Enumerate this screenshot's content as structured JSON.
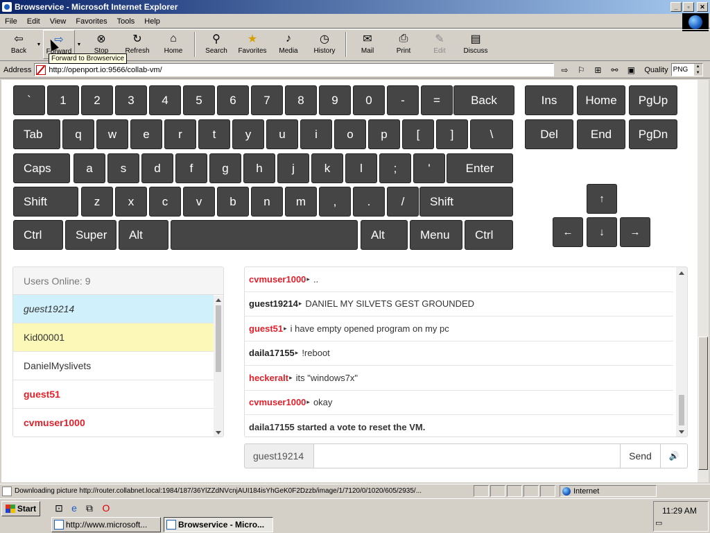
{
  "window": {
    "title": "Browservice - Microsoft Internet Explorer",
    "controls": [
      "_",
      "▫",
      "✕"
    ]
  },
  "menu": [
    "File",
    "Edit",
    "View",
    "Favorites",
    "Tools",
    "Help"
  ],
  "toolbar": {
    "buttons": [
      {
        "label": "Back",
        "icon": "back-arrow-icon",
        "glyph": "⇦"
      },
      {
        "label": "Forward",
        "icon": "forward-arrow-icon",
        "glyph": "⇨"
      },
      {
        "label": "Stop",
        "icon": "stop-icon",
        "glyph": "⊗"
      },
      {
        "label": "Refresh",
        "icon": "refresh-icon",
        "glyph": "↻"
      },
      {
        "label": "Home",
        "icon": "home-icon",
        "glyph": "⌂"
      },
      {
        "label": "Search",
        "icon": "search-icon",
        "glyph": "⚲"
      },
      {
        "label": "Favorites",
        "icon": "favorites-icon",
        "glyph": "★"
      },
      {
        "label": "Media",
        "icon": "media-icon",
        "glyph": "♪"
      },
      {
        "label": "History",
        "icon": "history-icon",
        "glyph": "◷"
      },
      {
        "label": "Mail",
        "icon": "mail-icon",
        "glyph": "✉"
      },
      {
        "label": "Print",
        "icon": "print-icon",
        "glyph": "⎙"
      },
      {
        "label": "Edit",
        "icon": "edit-icon",
        "glyph": "✎"
      },
      {
        "label": "Discuss",
        "icon": "discuss-icon",
        "glyph": "▤"
      }
    ],
    "tooltip": "Forward to Browservice"
  },
  "address": {
    "label": "Address",
    "url": "http://openport.io:9566/collab-vm/",
    "quality_label": "Quality",
    "quality_value": "PNG"
  },
  "keyboard": {
    "rows": [
      [
        "`",
        "1",
        "2",
        "3",
        "4",
        "5",
        "6",
        "7",
        "8",
        "9",
        "0",
        "-",
        "=",
        "Back"
      ],
      [
        "Tab",
        "q",
        "w",
        "e",
        "r",
        "t",
        "y",
        "u",
        "i",
        "o",
        "p",
        "[",
        "]",
        "\\"
      ],
      [
        "Caps",
        "a",
        "s",
        "d",
        "f",
        "g",
        "h",
        "j",
        "k",
        "l",
        ";",
        "'",
        "Enter"
      ],
      [
        "Shift",
        "z",
        "x",
        "c",
        "v",
        "b",
        "n",
        "m",
        ",",
        ".",
        "/",
        "Shift"
      ],
      [
        "Ctrl",
        "Super",
        "Alt",
        "",
        "Alt",
        "Menu",
        "Ctrl"
      ]
    ],
    "nav": [
      "Ins",
      "Home",
      "PgUp",
      "Del",
      "End",
      "PgDn"
    ],
    "arrows": {
      "up": "↑",
      "left": "←",
      "down": "↓",
      "right": "→"
    },
    "key_color": "#454545"
  },
  "users": {
    "header": "Users Online: 9",
    "list": [
      {
        "name": "guest19214",
        "style": "italic"
      },
      {
        "name": "Kid00001",
        "style": "yellow"
      },
      {
        "name": "DanielMyslivets",
        "style": "plain"
      },
      {
        "name": "guest51",
        "style": "red"
      },
      {
        "name": "cvmuser1000",
        "style": "red"
      }
    ]
  },
  "chat": {
    "separator": "▸",
    "messages": [
      {
        "user": "cvmuser1000",
        "color": "red",
        "text": ".."
      },
      {
        "user": "guest19214",
        "color": "blk",
        "text": "DANIEL MY SILVETS GEST GROUNDED"
      },
      {
        "user": "guest51",
        "color": "red",
        "text": "i have empty opened program on my pc"
      },
      {
        "user": "daila17155",
        "color": "blk",
        "text": "!reboot"
      },
      {
        "user": "heckeralt",
        "color": "red",
        "text": "its \"windows7x\""
      },
      {
        "user": "cvmuser1000",
        "color": "red",
        "text": "okay"
      }
    ],
    "system_message": "daila17155 started a vote to reset the VM.",
    "input_username": "guest19214",
    "input_value": "",
    "send_label": "Send",
    "volume_icon": "🔊"
  },
  "status": {
    "text": "Downloading picture http://router.collabnet.local:1984/187/36YlZZdNVcnjAUI184isYhGeK0F2Dzzb/image/1/7120/0/1020/605/2935/...",
    "zone": "Internet"
  },
  "taskbar": {
    "start_label": "Start",
    "tasks": [
      {
        "label": "http://www.microsoft...",
        "active": false
      },
      {
        "label": "Browservice - Micro...",
        "active": true
      }
    ],
    "clock": "11:29 AM"
  },
  "colors": {
    "username_red": "#e0202a",
    "titlebar_start": "#0a246a",
    "titlebar_end": "#a6caf0"
  }
}
